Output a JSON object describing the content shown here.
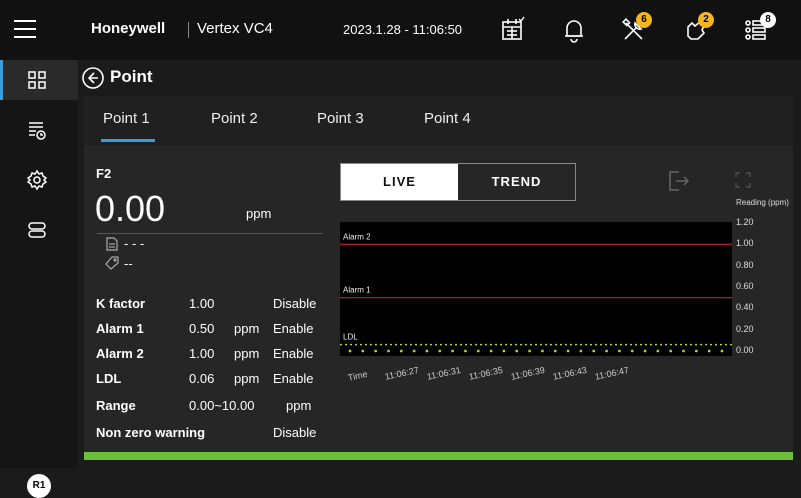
{
  "topbar": {
    "brand": "Honeywell",
    "model": "Vertex VC4",
    "datetime": "2023.1.28 - 11:06:50",
    "icons": [
      "menu-icon",
      "calendar-icon",
      "bell-icon",
      "tools-icon",
      "hand-icon",
      "list-icon"
    ],
    "badges": {
      "tools": "6",
      "hand": "2",
      "list": "8"
    }
  },
  "sidebar": {
    "items": [
      "grid-icon",
      "history-list-icon",
      "gear-icon",
      "device-icon"
    ],
    "user_badge": "R1"
  },
  "header": {
    "title": "Point"
  },
  "tabs": [
    {
      "label": "Point 1",
      "active": true
    },
    {
      "label": "Point 2"
    },
    {
      "label": "Point 3"
    },
    {
      "label": "Point 4"
    }
  ],
  "point": {
    "gas": "F2",
    "reading": "0.00",
    "unit": "ppm",
    "field1": "- - -",
    "field2": "--",
    "k_factor_label": "K factor",
    "k_factor": "1.00",
    "k_factor_status": "Disable",
    "alarm1_label": "Alarm 1",
    "alarm1": "0.50",
    "alarm1_unit": "ppm",
    "alarm1_status": "Enable",
    "alarm2_label": "Alarm 2",
    "alarm2": "1.00",
    "alarm2_unit": "ppm",
    "alarm2_status": "Enable",
    "ldl_label": "LDL",
    "ldl": "0.06",
    "ldl_unit": "ppm",
    "ldl_status": "Enable",
    "range_label": "Range",
    "range": "0.00~10.00",
    "range_unit": "ppm",
    "nonzero_label": "Non zero warning",
    "nonzero_status": "Disable"
  },
  "chart_controls": {
    "live": "LIVE",
    "trend": "TREND"
  },
  "colors": {
    "accent": "#3a9fd8",
    "alarm_line": "#c0282f",
    "ldl_line": "#a6d63a",
    "status_bar": "#6bbf3a",
    "badge": "#f5b51e"
  },
  "chart_data": {
    "type": "line",
    "ylabel": "Reading (ppm)",
    "xlabel": "Time",
    "y_ticks": [
      "1.20",
      "1.00",
      "0.80",
      "0.60",
      "0.40",
      "0.20",
      "0.00"
    ],
    "ylim": [
      0,
      1.2
    ],
    "x": [
      "11:06:27",
      "11:06:31",
      "11:06:35",
      "11:06:39",
      "11:06:43",
      "11:06:47"
    ],
    "reference_lines": [
      {
        "name": "Alarm 2",
        "value": 1.0
      },
      {
        "name": "Alarm 1",
        "value": 0.5
      },
      {
        "name": "LDL",
        "value": 0.06
      }
    ],
    "series": [
      {
        "values": [
          0,
          0,
          0,
          0,
          0,
          0
        ]
      }
    ]
  }
}
